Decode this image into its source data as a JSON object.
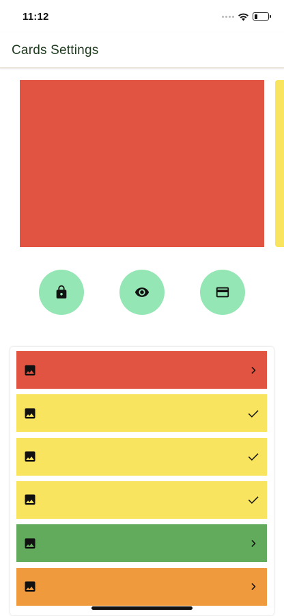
{
  "status_bar": {
    "time": "11:12",
    "icons": [
      "signal-dots-icon",
      "wifi-icon",
      "battery-icon"
    ],
    "battery_level": 0.25
  },
  "app_bar": {
    "title": "Cards Settings"
  },
  "carousel": {
    "current_card_color": "#e05441",
    "next_card_color": "#f9e45f"
  },
  "actions": [
    {
      "name": "lock",
      "icon": "lock-icon"
    },
    {
      "name": "visibility",
      "icon": "eye-icon"
    },
    {
      "name": "card",
      "icon": "credit-card-icon"
    }
  ],
  "colors": {
    "accent": "#94e6b4",
    "red": "#e05441",
    "yellow": "#f9e45f",
    "green": "#62aa5c",
    "orange": "#f09a3e"
  },
  "card_list": [
    {
      "color": "#e05441",
      "icon": "image-icon",
      "trailing": "chevron-right-icon",
      "selected": false
    },
    {
      "color": "#f9e45f",
      "icon": "image-icon",
      "trailing": "check-icon",
      "selected": true
    },
    {
      "color": "#f9e45f",
      "icon": "image-icon",
      "trailing": "check-icon",
      "selected": true
    },
    {
      "color": "#f9e45f",
      "icon": "image-icon",
      "trailing": "check-icon",
      "selected": true
    },
    {
      "color": "#62aa5c",
      "icon": "image-icon",
      "trailing": "chevron-right-icon",
      "selected": false
    },
    {
      "color": "#f09a3e",
      "icon": "image-icon",
      "trailing": "chevron-right-icon",
      "selected": false
    }
  ]
}
